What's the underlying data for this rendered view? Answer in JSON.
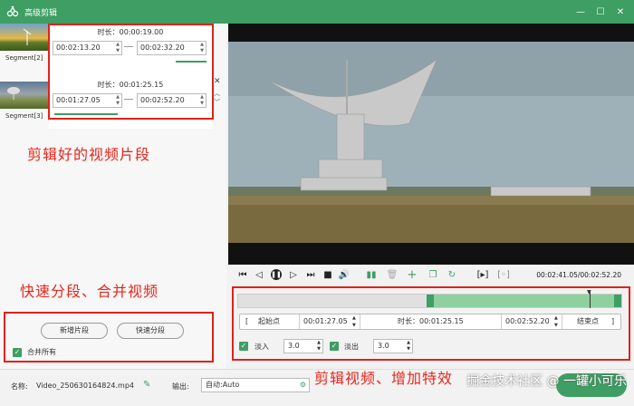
{
  "window": {
    "title": "高级剪辑",
    "buttons": [
      "minimize-icon",
      "maximize-icon",
      "close-icon"
    ]
  },
  "segments": [
    {
      "label": "Segment[2]",
      "duration": "时长：00:00:19.00",
      "start": "00:02:13.20",
      "end": "00:02:32.20"
    },
    {
      "label": "Segment[3]",
      "duration": "时长：00:01:25.15",
      "start": "00:01:27.05",
      "end": "00:02:52.20"
    }
  ],
  "annotations": {
    "clips": "剪辑好的视频片段",
    "split_merge": "快速分段、合并视频",
    "edit": "剪辑视频、增加特效"
  },
  "left_buttons": {
    "add_segment": "新增片段",
    "quick_split": "快速分段",
    "merge_all": "合并所有"
  },
  "player": {
    "time": "00:02:41.05/00:02:52.20"
  },
  "editor": {
    "start_label": "起始点",
    "start_time": "00:01:27.05",
    "duration": "时长：00:01:25.15",
    "end_time": "00:02:52.20",
    "end_label": "结束点",
    "fade_in_label": "淡入",
    "fade_in_value": "3.0",
    "fade_out_label": "淡出",
    "fade_out_value": "3.0"
  },
  "bottom": {
    "name_label": "名称:",
    "file_name": "Video_250630164824.mp4",
    "output_label": "输出:",
    "output_value": "自动:Auto"
  },
  "watermark": "掘金技术社区 @ 一罐小可乐",
  "colors": {
    "accent": "#3e9e63",
    "annotation": "#e8261d"
  }
}
